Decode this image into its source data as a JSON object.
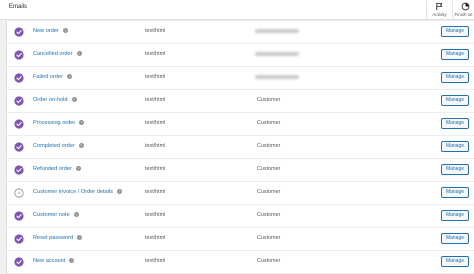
{
  "header": {
    "title": "Emails",
    "actions": [
      {
        "label": "Activity",
        "icon": "flag-icon"
      },
      {
        "label": "Finish se",
        "icon": "progress-icon"
      }
    ]
  },
  "colors": {
    "enabled": "#7f54b3",
    "link": "#2271b1",
    "button_border": "#2271b1"
  },
  "emails": [
    {
      "name": "New order",
      "content_type": "text/html",
      "recipient": "",
      "recipient_hidden": true,
      "enabled": true,
      "manage_label": "Manage"
    },
    {
      "name": "Cancelled order",
      "content_type": "text/html",
      "recipient": "",
      "recipient_hidden": true,
      "enabled": true,
      "manage_label": "Manage"
    },
    {
      "name": "Failed order",
      "content_type": "text/html",
      "recipient": "",
      "recipient_hidden": true,
      "enabled": true,
      "manage_label": "Manage"
    },
    {
      "name": "Order on-hold",
      "content_type": "text/html",
      "recipient": "Customer",
      "recipient_hidden": false,
      "enabled": true,
      "manage_label": "Manage"
    },
    {
      "name": "Processing order",
      "content_type": "text/html",
      "recipient": "Customer",
      "recipient_hidden": false,
      "enabled": true,
      "manage_label": "Manage"
    },
    {
      "name": "Completed order",
      "content_type": "text/html",
      "recipient": "Customer",
      "recipient_hidden": false,
      "enabled": true,
      "manage_label": "Manage"
    },
    {
      "name": "Refunded order",
      "content_type": "text/html",
      "recipient": "Customer",
      "recipient_hidden": false,
      "enabled": true,
      "manage_label": "Manage"
    },
    {
      "name": "Customer invoice / Order details",
      "content_type": "text/html",
      "recipient": "Customer",
      "recipient_hidden": false,
      "enabled": false,
      "manage_label": "Manage"
    },
    {
      "name": "Customer note",
      "content_type": "text/html",
      "recipient": "Customer",
      "recipient_hidden": false,
      "enabled": true,
      "manage_label": "Manage"
    },
    {
      "name": "Reset password",
      "content_type": "text/html",
      "recipient": "Customer",
      "recipient_hidden": false,
      "enabled": true,
      "manage_label": "Manage"
    },
    {
      "name": "New account",
      "content_type": "text/html",
      "recipient": "Customer",
      "recipient_hidden": false,
      "enabled": true,
      "manage_label": "Manage"
    }
  ]
}
